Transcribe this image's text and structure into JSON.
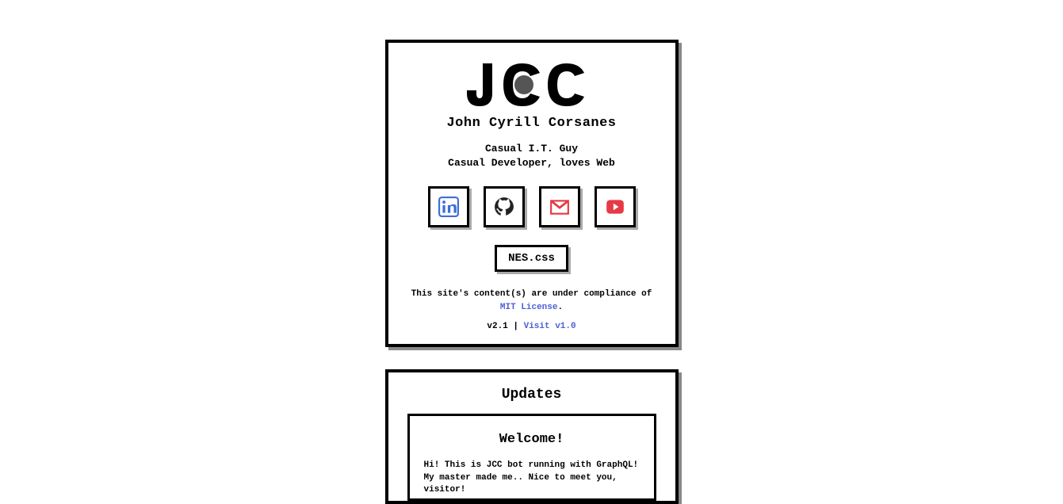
{
  "header": {
    "name": "John Cyrill Corsanes",
    "subtitle_line1": "Casual I.T. Guy",
    "subtitle_line2": "Casual Developer, loves Web"
  },
  "social": {
    "linkedin": "linkedin",
    "github": "github",
    "gmail": "gmail",
    "youtube": "youtube"
  },
  "nes_button": "NES.css",
  "license": {
    "text_before": "This site's content(s) are under compliance of ",
    "link_text": "MIT License",
    "text_after": "."
  },
  "version": {
    "label": "v2.1 | ",
    "link_text": "Visit v1.0"
  },
  "updates": {
    "title": "Updates",
    "welcome_title": "Welcome!",
    "welcome_text": "Hi! This is JCC bot running with GraphQL! My master made me.. Nice to meet you, visitor!"
  }
}
